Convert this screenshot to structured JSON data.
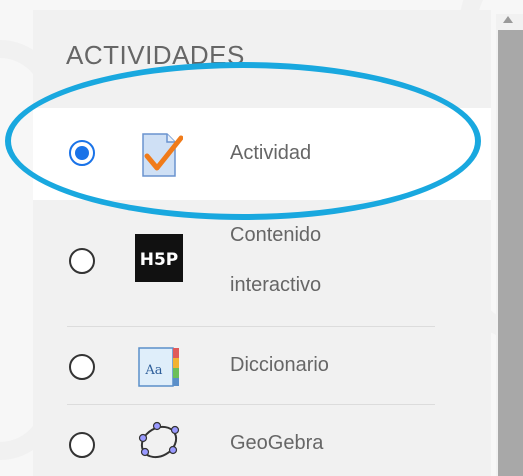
{
  "section": {
    "title": "ACTIVIDADES"
  },
  "items": [
    {
      "label": "Actividad",
      "icon": "assignment-check-icon",
      "selected": true
    },
    {
      "label": "Contenido interactivo",
      "label_line1": "Contenido",
      "label_line2": "interactivo",
      "icon": "h5p-icon",
      "selected": false
    },
    {
      "label": "Diccionario",
      "icon": "glossary-icon",
      "selected": false
    },
    {
      "label": "GeoGebra",
      "icon": "geogebra-icon",
      "selected": false
    }
  ],
  "colors": {
    "highlight_ellipse": "#19a8df",
    "radio_selected": "#1a73e8",
    "scrollbar_thumb": "#a8a8a8"
  }
}
